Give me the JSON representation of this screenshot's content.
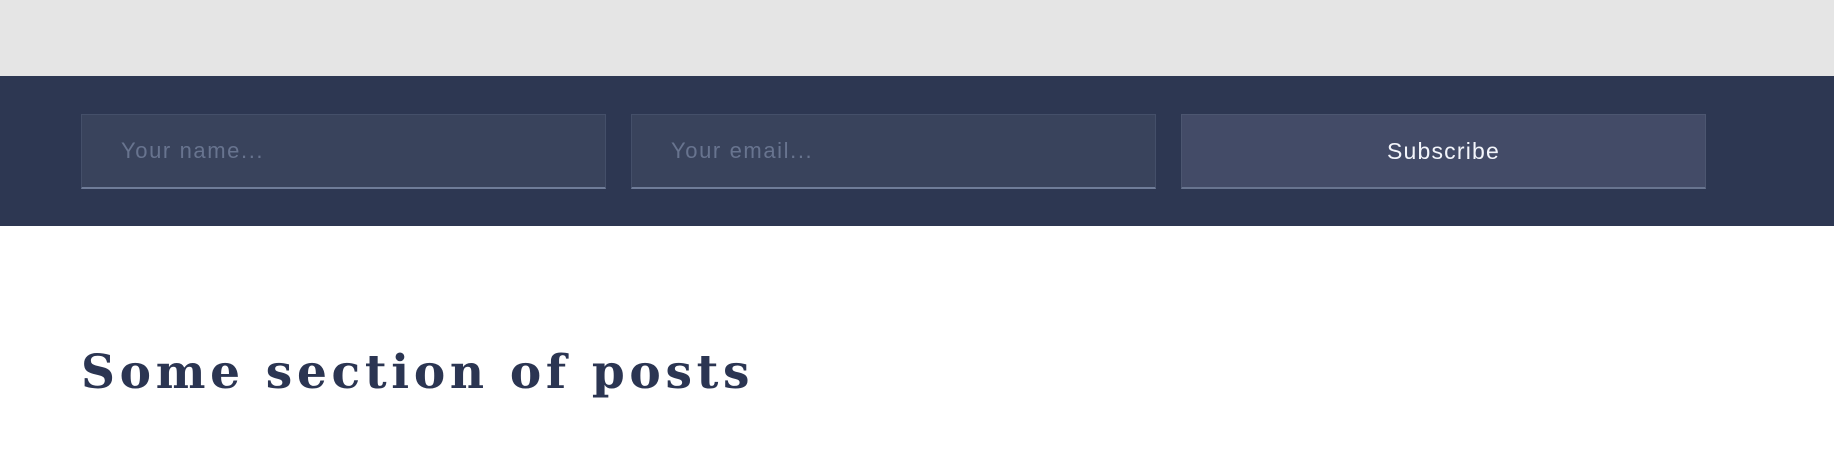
{
  "subscribe": {
    "name_placeholder": "Your name...",
    "email_placeholder": "Your email...",
    "button_label": "Subscribe"
  },
  "posts_section": {
    "title": "Some section of posts"
  },
  "colors": {
    "top_strip": "#e5e5e5",
    "subscribe_bar": "#2d3752",
    "input_background": "#39435c",
    "button_background": "#434b67",
    "title_text": "#2b3552"
  }
}
